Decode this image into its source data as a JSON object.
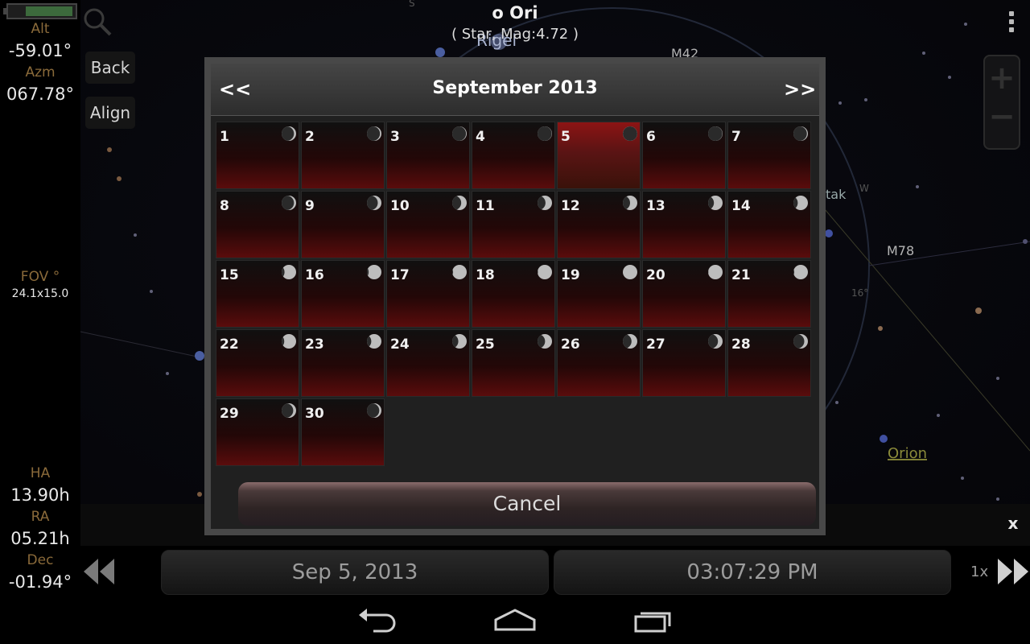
{
  "header": {
    "title": "o Ori",
    "subtitle": "( Star, Mag:4.72 )"
  },
  "left_panel": {
    "alt_label": "Alt",
    "alt_value": "-59.01°",
    "azm_label": "Azm",
    "azm_value": "067.78°",
    "fov_label": "FOV °",
    "fov_value": "24.1x15.0",
    "ha_label": "HA",
    "ha_value": "13.90h",
    "ra_label": "RA",
    "ra_value": "05.21h",
    "dec_label": "Dec",
    "dec_value": "-01.94°"
  },
  "buttons": {
    "back": "Back",
    "align": "Align",
    "close": "x"
  },
  "sky_labels": {
    "rigel": "Rigel",
    "m42": "M42",
    "m78": "M78",
    "orion": "Orion",
    "compass_s": "S",
    "compass_w": "W",
    "deg16": "16°",
    "partial_tak": "tak"
  },
  "bottom_bar": {
    "date": "Sep 5, 2013",
    "time": "03:07:29 PM",
    "speed": "1x"
  },
  "calendar": {
    "prev_label": "<<",
    "next_label": ">>",
    "month_title": "September 2013",
    "selected_day": 5,
    "days": [
      {
        "day": "1",
        "phase": 0.85
      },
      {
        "day": "2",
        "phase": 0.9
      },
      {
        "day": "3",
        "phase": 0.95
      },
      {
        "day": "4",
        "phase": 0.98
      },
      {
        "day": "5",
        "phase": 1.0
      },
      {
        "day": "6",
        "phase": 0.98
      },
      {
        "day": "7",
        "phase": 0.93
      },
      {
        "day": "8",
        "phase": 0.85
      },
      {
        "day": "9",
        "phase": 0.75
      },
      {
        "day": "10",
        "phase": 0.62
      },
      {
        "day": "11",
        "phase": 0.55
      },
      {
        "day": "12",
        "phase": 0.5
      },
      {
        "day": "13",
        "phase": 0.4
      },
      {
        "day": "14",
        "phase": 0.3
      },
      {
        "day": "15",
        "phase": 0.2
      },
      {
        "day": "16",
        "phase": 0.12
      },
      {
        "day": "17",
        "phase": 0.06
      },
      {
        "day": "18",
        "phase": 0.03
      },
      {
        "day": "19",
        "phase": 0.0
      },
      {
        "day": "20",
        "phase": 0.02
      },
      {
        "day": "21",
        "phase": 0.06
      },
      {
        "day": "22",
        "phase": 0.18
      },
      {
        "day": "23",
        "phase": 0.3
      },
      {
        "day": "24",
        "phase": 0.42
      },
      {
        "day": "25",
        "phase": 0.52
      },
      {
        "day": "26",
        "phase": 0.6
      },
      {
        "day": "27",
        "phase": 0.68
      },
      {
        "day": "28",
        "phase": 0.75
      },
      {
        "day": "29",
        "phase": 0.8
      },
      {
        "day": "30",
        "phase": 0.85
      }
    ],
    "cancel_label": "Cancel"
  },
  "icons": [
    "search-icon",
    "menu-icon",
    "zoom-in-icon",
    "zoom-out-icon",
    "rewind-icon",
    "fast-forward-icon",
    "back-nav-icon",
    "home-nav-icon",
    "recents-nav-icon"
  ]
}
